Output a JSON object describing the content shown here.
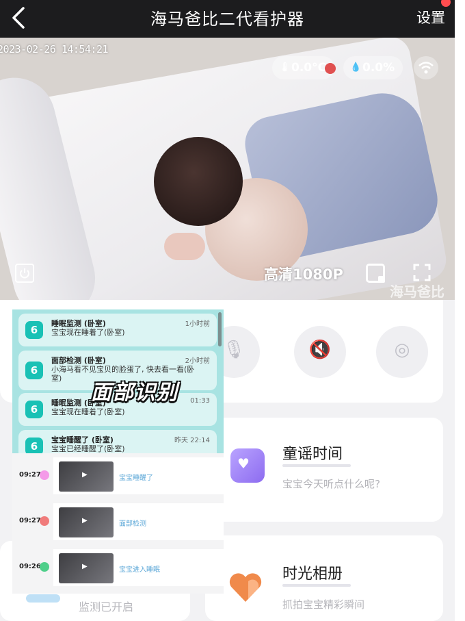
{
  "header": {
    "title": "海马爸比二代看护器",
    "settings_label": "设置"
  },
  "video": {
    "timestamp": "2023-02-26   14:54:21",
    "temperature": "0.0°C",
    "humidity": "0.0%",
    "quality": "高清1080P",
    "watermark": "海马爸比"
  },
  "notifications": [
    {
      "title": "睡眠监测 (卧室)",
      "body": "宝宝现在睡着了(卧室)",
      "time": "1小时前"
    },
    {
      "title": "面部检测 (卧室)",
      "body": "小海马看不见宝贝的脸蛋了, 快去看一看(卧室)",
      "time": "2小时前"
    },
    {
      "title": "睡眠监测 (卧室)",
      "body": "宝宝现在睡着了(卧室)",
      "time": "01:33"
    },
    {
      "title": "宝宝睡醒了 (卧室)",
      "body": "宝宝已经睡醒了(卧室)",
      "time": "昨天 22:14"
    }
  ],
  "overlay_caption": "面部识别",
  "events": [
    {
      "time": "09:27",
      "label": "宝宝睡醒了",
      "color": "#f49ae8"
    },
    {
      "time": "09:27",
      "label": "面部检测",
      "color": "#f07b7b"
    },
    {
      "time": "09:26",
      "label": "宝宝进入睡眠",
      "color": "#4fcf8a"
    }
  ],
  "cards": {
    "song": {
      "title": "童谣时间",
      "subtitle": "宝宝今天听点什么呢?"
    },
    "album": {
      "title": "时光相册",
      "subtitle": "抓拍宝宝精彩瞬间"
    },
    "monitor": {
      "status": "监测已开启"
    }
  },
  "icons": [
    "back-icon",
    "thermometer-icon",
    "humidity-icon",
    "wifi-icon",
    "power-icon",
    "pip-icon",
    "fullscreen-icon",
    "mic-icon",
    "mute-icon",
    "ptz-icon",
    "music-box-icon",
    "heart-album-icon"
  ]
}
